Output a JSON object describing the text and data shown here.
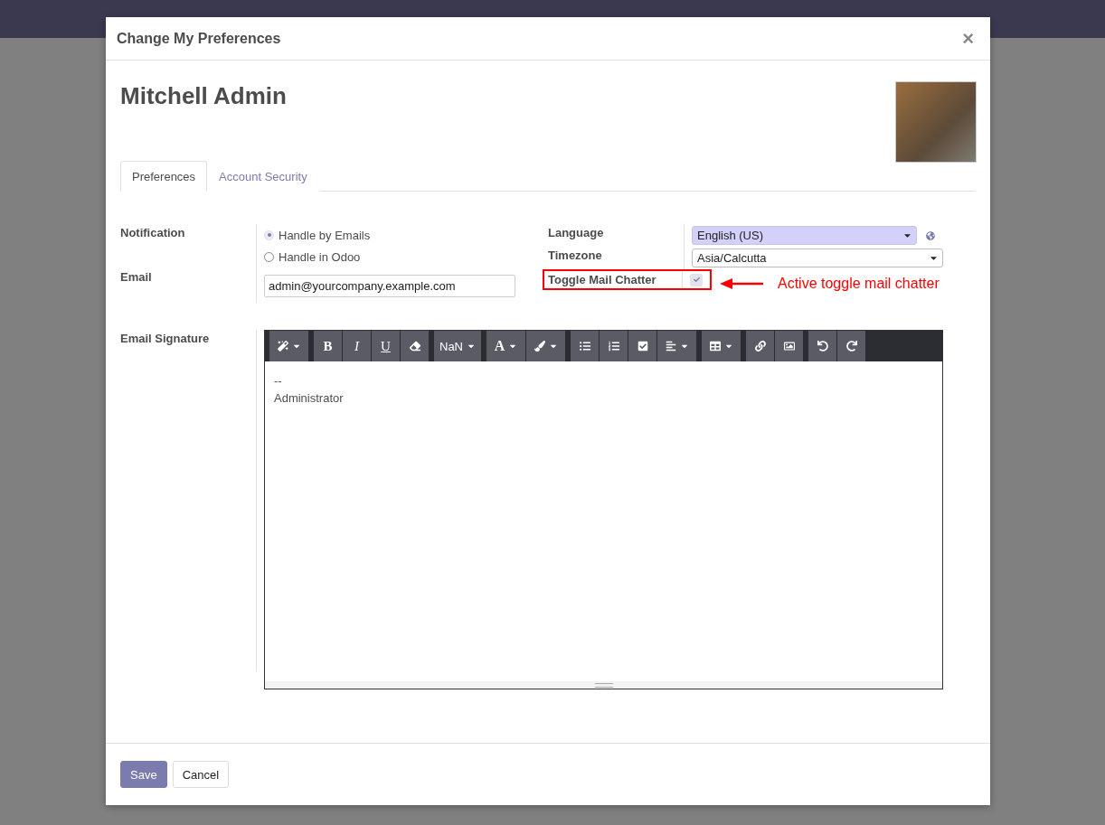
{
  "dialog": {
    "title": "Change My Preferences",
    "close": "×"
  },
  "user": {
    "name": "Mitchell Admin"
  },
  "tabs": [
    {
      "label": "Preferences",
      "selected": true
    },
    {
      "label": "Account Security",
      "selected": false
    }
  ],
  "notification": {
    "label": "Notification",
    "options": [
      {
        "label": "Handle by Emails",
        "selected": true
      },
      {
        "label": "Handle in Odoo",
        "selected": false
      }
    ]
  },
  "email": {
    "label": "Email",
    "value": "admin@yourcompany.example.com"
  },
  "language": {
    "label": "Language",
    "value": "English (US)"
  },
  "timezone": {
    "label": "Timezone",
    "value": "Asia/Calcutta"
  },
  "toggle_mail_chatter": {
    "label": "Toggle Mail Chatter",
    "checked": true
  },
  "annotation": {
    "text": "Active toggle mail chatter"
  },
  "signature": {
    "label": "Email Signature",
    "lines": [
      "--",
      "Administrator"
    ],
    "toolbar": [
      [
        {
          "kind": "magic",
          "dropdown": true
        }
      ],
      [
        {
          "kind": "bold",
          "label": "B"
        },
        {
          "kind": "italic",
          "label": "I"
        },
        {
          "kind": "underline",
          "label": "U"
        },
        {
          "kind": "eraser"
        }
      ],
      [
        {
          "kind": "fontsize",
          "label": "NaN",
          "dropdown": true
        }
      ],
      [
        {
          "kind": "fontcolor",
          "label": "A",
          "dropdown": true
        },
        {
          "kind": "brush",
          "dropdown": true
        }
      ],
      [
        {
          "kind": "ul"
        },
        {
          "kind": "ol"
        },
        {
          "kind": "check"
        },
        {
          "kind": "align",
          "dropdown": true
        }
      ],
      [
        {
          "kind": "table",
          "dropdown": true
        }
      ],
      [
        {
          "kind": "link"
        },
        {
          "kind": "image"
        }
      ],
      [
        {
          "kind": "undo"
        },
        {
          "kind": "redo"
        }
      ]
    ]
  },
  "buttons": [
    {
      "label": "Save",
      "kind": "primary"
    },
    {
      "label": "Cancel",
      "kind": "secondary"
    }
  ]
}
